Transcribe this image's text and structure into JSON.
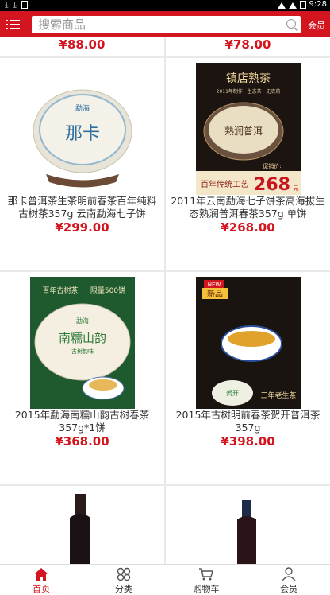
{
  "status_bar": {
    "time": "9:28"
  },
  "header": {
    "search_placeholder": "搜索商品",
    "member_label": "会员"
  },
  "top_row": [
    {
      "price": "¥88.00"
    },
    {
      "price": "¥78.00"
    }
  ],
  "products": [
    {
      "title": "那卡普洱茶生茶明前春茶百年纯料古树茶357g 云南勐海七子饼",
      "price": "¥299.00",
      "image_text": "那卡"
    },
    {
      "title": "2011年云南勐海七子饼茶高海拔生态熟润普洱春茶357g 单饼",
      "price": "¥268.00",
      "image_text": "镇店熟茶"
    },
    {
      "title": "2015年勐海南糯山韵古树春茶357g*1饼",
      "price": "¥368.00",
      "image_text": "南糯山韵"
    },
    {
      "title": "2015年古树明前春茶贺开普洱茶357g",
      "price": "¥398.00",
      "image_text": "新品"
    }
  ],
  "image_texts": {
    "p2_sub": "2011年制作 · 生态茶 · 无农药",
    "p2_name": "熟润普洱",
    "p2_banner": "百年传统工艺",
    "p2_price_label": "促销价:",
    "p2_price": "268",
    "p2_unit": "元",
    "p3_top1": "百年古树茶",
    "p3_top2": "限量500饼",
    "p3_cake": "勐海",
    "p3_sub": "古树韵味",
    "p4_new": "NEW",
    "p4_cake": "贺开",
    "p4_banner": "三年老生茶",
    "p1_cake": "勐海"
  },
  "tabbar": [
    {
      "label": "首页",
      "icon": "home-icon"
    },
    {
      "label": "分类",
      "icon": "category-icon"
    },
    {
      "label": "购物车",
      "icon": "cart-icon"
    },
    {
      "label": "会员",
      "icon": "user-icon"
    }
  ],
  "colors": {
    "brand": "#d2151e"
  }
}
